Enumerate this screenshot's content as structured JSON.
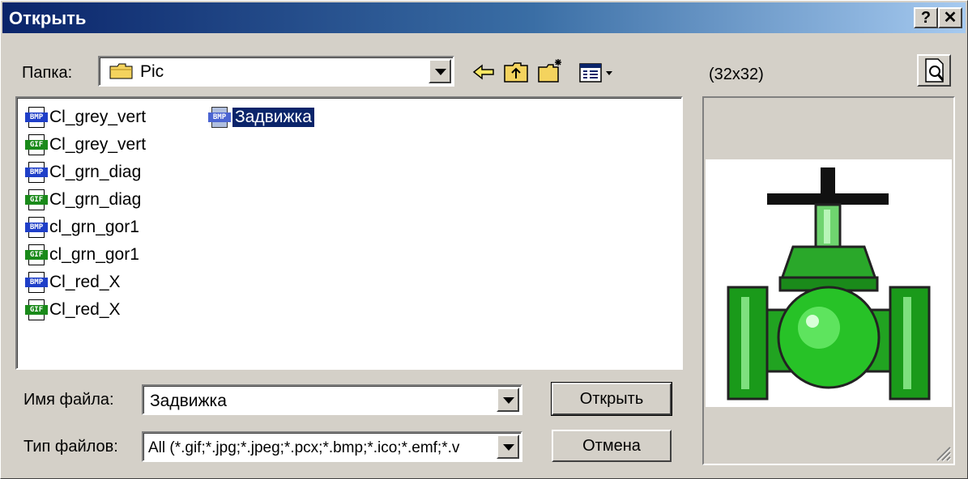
{
  "window": {
    "title": "Открыть",
    "help_label": "?",
    "close_label": "✕"
  },
  "folder": {
    "label": "Папка:",
    "value": "Pic"
  },
  "preview": {
    "size_label": "(32x32)"
  },
  "files": [
    {
      "name": "Cl_grey_vert",
      "type": "BMP"
    },
    {
      "name": "Cl_grey_vert",
      "type": "GIF"
    },
    {
      "name": "Cl_grn_diag",
      "type": "BMP"
    },
    {
      "name": "Cl_grn_diag",
      "type": "GIF"
    },
    {
      "name": "cl_grn_gor1",
      "type": "BMP"
    },
    {
      "name": "cl_grn_gor1",
      "type": "GIF"
    },
    {
      "name": "Cl_red_X",
      "type": "BMP"
    },
    {
      "name": "Cl_red_X",
      "type": "GIF"
    },
    {
      "name": "Задвижка",
      "type": "BMP",
      "selected": true
    }
  ],
  "filename": {
    "label": "Имя файла:",
    "value": "Задвижка"
  },
  "filetype": {
    "label": "Тип файлов:",
    "value": "All (*.gif;*.jpg;*.jpeg;*.pcx;*.bmp;*.ico;*.emf;*.v"
  },
  "buttons": {
    "open": "Открыть",
    "cancel": "Отмена"
  },
  "icons": {
    "folder": "folder-icon",
    "back": "back-arrow-icon",
    "up": "up-folder-icon",
    "new_folder": "new-folder-icon",
    "view": "view-menu-icon",
    "preview": "preview-icon"
  }
}
